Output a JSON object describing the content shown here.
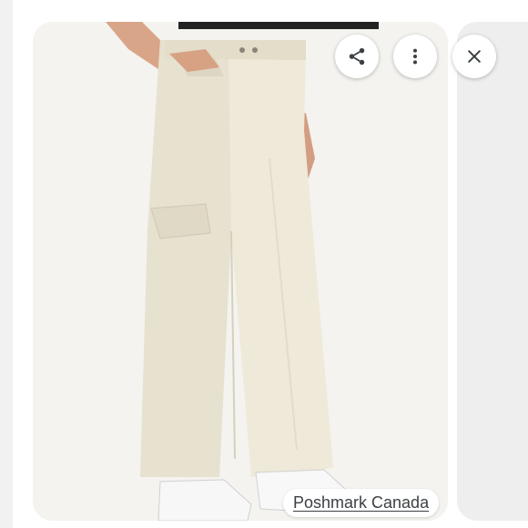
{
  "viewer": {
    "source_label": "Poshmark Canada",
    "product_image_icon": "cream-cargo-pants-photo",
    "actions": {
      "share_icon": "share-icon",
      "more_icon": "more-vert-icon",
      "close_icon": "close-icon"
    }
  },
  "colors": {
    "fabric": "#ece6d6",
    "background": "#f3f2ef",
    "chip_text": "#3c4043"
  }
}
